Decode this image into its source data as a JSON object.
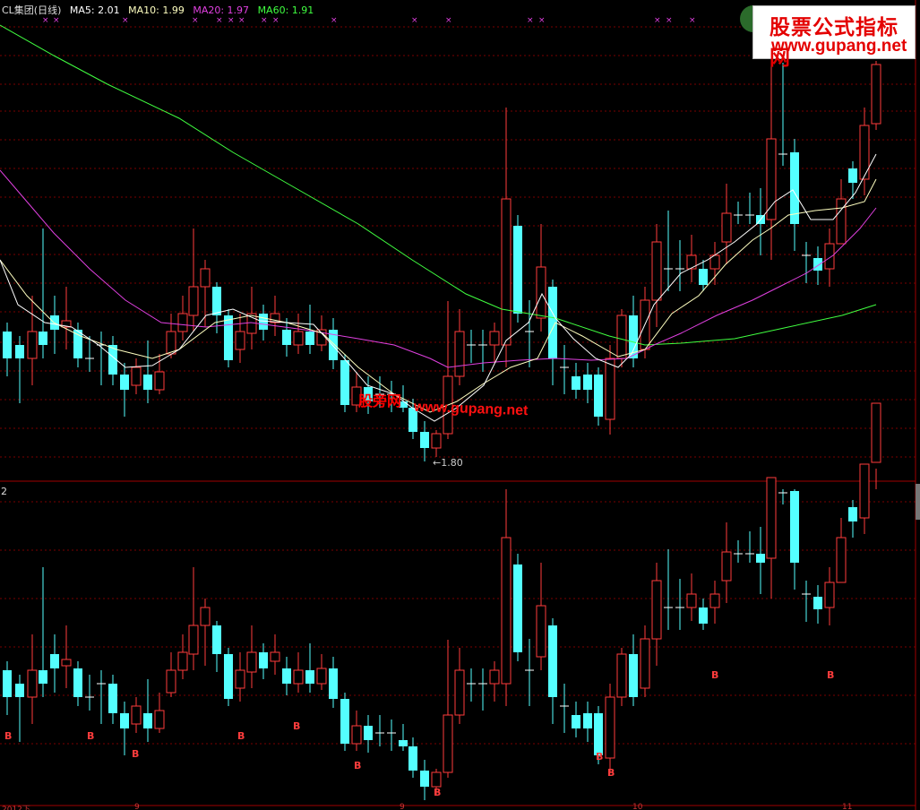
{
  "header": {
    "title": "CL集团(日线)",
    "ma5": "MA5: 2.01",
    "ma10": "MA10: 1.99",
    "ma20": "MA20: 1.97",
    "ma60": "MA60: 1.91"
  },
  "lower_panel_label": "2",
  "low_marker": "1.80",
  "logo": {
    "line1": "股票公式指标网",
    "line2": "www.gupang.net"
  },
  "watermark": {
    "cn": "股旁网",
    "url": "www.gupang.net"
  },
  "xaxis": {
    "labels": [
      "2012下",
      "9",
      "9",
      "10",
      "11"
    ]
  },
  "colors": {
    "up": "#ff3c3c",
    "down": "#54ffff",
    "ma5": "#ffffff",
    "ma10": "#ffffc0",
    "ma20": "#e040e0",
    "ma60": "#40ff40",
    "grid": "#7a0000",
    "signal_b": "#ff3c3c",
    "cross": "#e040e0"
  },
  "chart_data": {
    "type": "candlestick",
    "title": "CL集团(日线)",
    "ylabel": "",
    "low_annotation": 1.8,
    "series": [
      {
        "name": "MA5",
        "last": 2.01
      },
      {
        "name": "MA10",
        "last": 1.99
      },
      {
        "name": "MA20",
        "last": 1.97
      },
      {
        "name": "MA60",
        "last": 1.91
      }
    ]
  }
}
